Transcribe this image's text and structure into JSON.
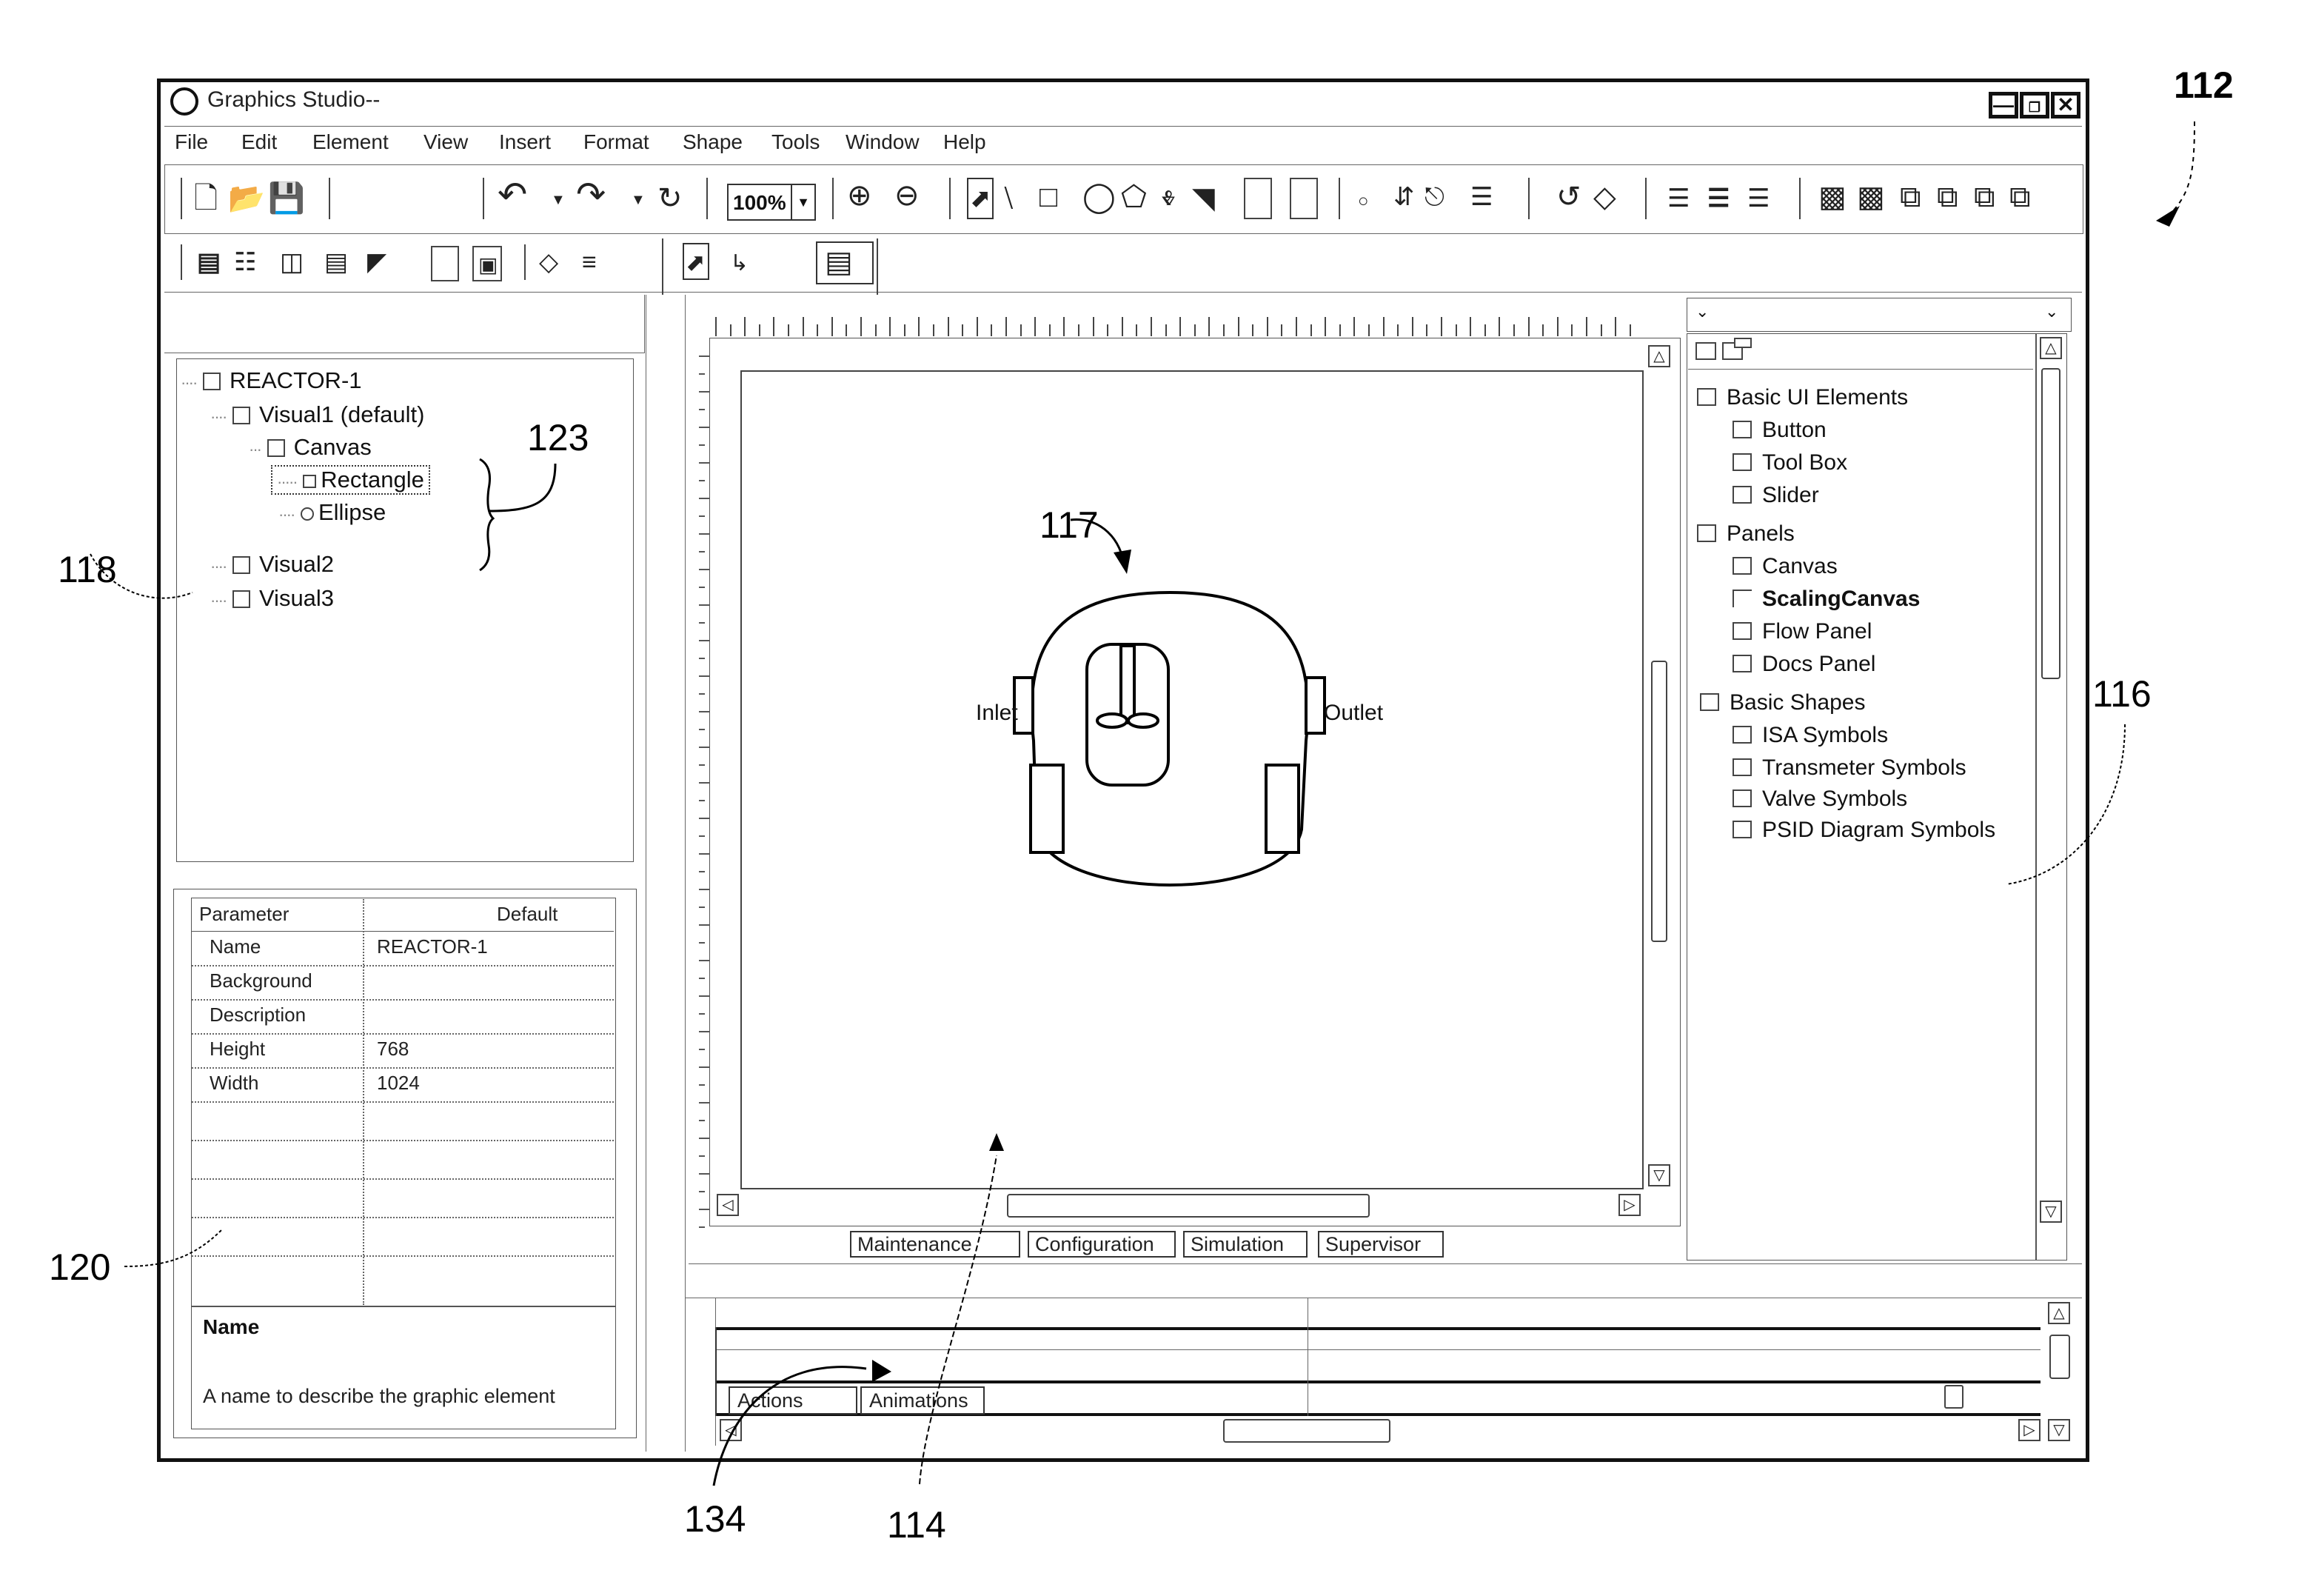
{
  "window": {
    "title": "Graphics Studio--",
    "controls": [
      "minimize",
      "restore",
      "close"
    ]
  },
  "menubar": {
    "items": [
      "File",
      "Edit",
      "Element",
      "View",
      "Insert",
      "Format",
      "Shape",
      "Tools",
      "Window",
      "Help"
    ]
  },
  "toolbar1": {
    "zoom_value": "100%",
    "icons": [
      "new-document-icon",
      "open-icon",
      "save-icon",
      "undo-icon",
      "undo-dropdown-icon",
      "redo-icon",
      "redo-dropdown-icon",
      "refresh-icon",
      "zoom-in-icon",
      "zoom-out-icon",
      "pointer-icon",
      "line-icon",
      "rectangle-icon",
      "ellipse-icon",
      "pentagon-icon",
      "polyline-icon",
      "polygon-icon",
      "tall-rectangle-icon",
      "panel-icon",
      "small-circle-icon",
      "connector-icon",
      "flow-connector-icon",
      "text-lines-icon",
      "rotate-icon",
      "flip-icon",
      "align-left-icon",
      "align-center-icon",
      "align-right-icon",
      "group-icon",
      "ungroup-icon",
      "bring-front-icon",
      "send-back-icon",
      "bring-forward-icon",
      "send-backward-icon"
    ]
  },
  "toolbar2": {
    "icons": [
      "align-tools-icon",
      "distribute-icon",
      "size-tools-icon",
      "chart-tools-icon",
      "frame-icon",
      "embed-icon",
      "diamond-icon",
      "lines-icon",
      "select-pointer-icon",
      "connector-tool-icon",
      "layout-icon"
    ]
  },
  "tree": {
    "nodes": [
      {
        "label": "REACTOR-1",
        "icon": "square",
        "level": 0
      },
      {
        "label": "Visual1 (default)",
        "icon": "square",
        "level": 1
      },
      {
        "label": "Canvas",
        "icon": "square",
        "level": 2
      },
      {
        "label": "Rectangle",
        "icon": "small-square",
        "level": 3,
        "selected": true
      },
      {
        "label": "Ellipse",
        "icon": "circle",
        "level": 3
      },
      {
        "label": "Visual2",
        "icon": "square",
        "level": 1
      },
      {
        "label": "Visual3",
        "icon": "square",
        "level": 1
      }
    ]
  },
  "properties": {
    "headers": [
      "Parameter",
      "Default"
    ],
    "rows": [
      {
        "param": "Name",
        "value": "REACTOR-1"
      },
      {
        "param": "Background",
        "value": ""
      },
      {
        "param": "Description",
        "value": ""
      },
      {
        "param": "Height",
        "value": "768"
      },
      {
        "param": "Width",
        "value": "1024"
      },
      {
        "param": "",
        "value": ""
      },
      {
        "param": "",
        "value": ""
      },
      {
        "param": "",
        "value": ""
      },
      {
        "param": "",
        "value": ""
      },
      {
        "param": "",
        "value": ""
      }
    ],
    "description_title": "Name",
    "description_text": "A name to describe the graphic element"
  },
  "canvas": {
    "labels": {
      "inlet": "Inlet",
      "outlet": "Outlet"
    },
    "tabs": [
      "Maintenance",
      "Configuration",
      "Simulation",
      "Supervisor"
    ]
  },
  "library": {
    "combo_value": "",
    "groups": [
      {
        "label": "Basic UI Elements",
        "items": [
          "Button",
          "Tool Box",
          "Slider"
        ]
      },
      {
        "label": "Panels",
        "items": [
          "Canvas",
          "ScalingCanvas",
          "Flow Panel",
          "Docs Panel"
        ]
      },
      {
        "label": "Basic Shapes",
        "items": [
          "ISA Symbols",
          "Transmeter Symbols",
          "Valve Symbols",
          "PSID Diagram Symbols"
        ]
      }
    ]
  },
  "bottom_panel": {
    "tabs": [
      "Actions",
      "Animations"
    ]
  },
  "annotations": {
    "r112": "112",
    "r114": "114",
    "r116": "116",
    "r117": "117",
    "r118": "118",
    "r120": "120",
    "r123": "123",
    "r134": "134"
  }
}
